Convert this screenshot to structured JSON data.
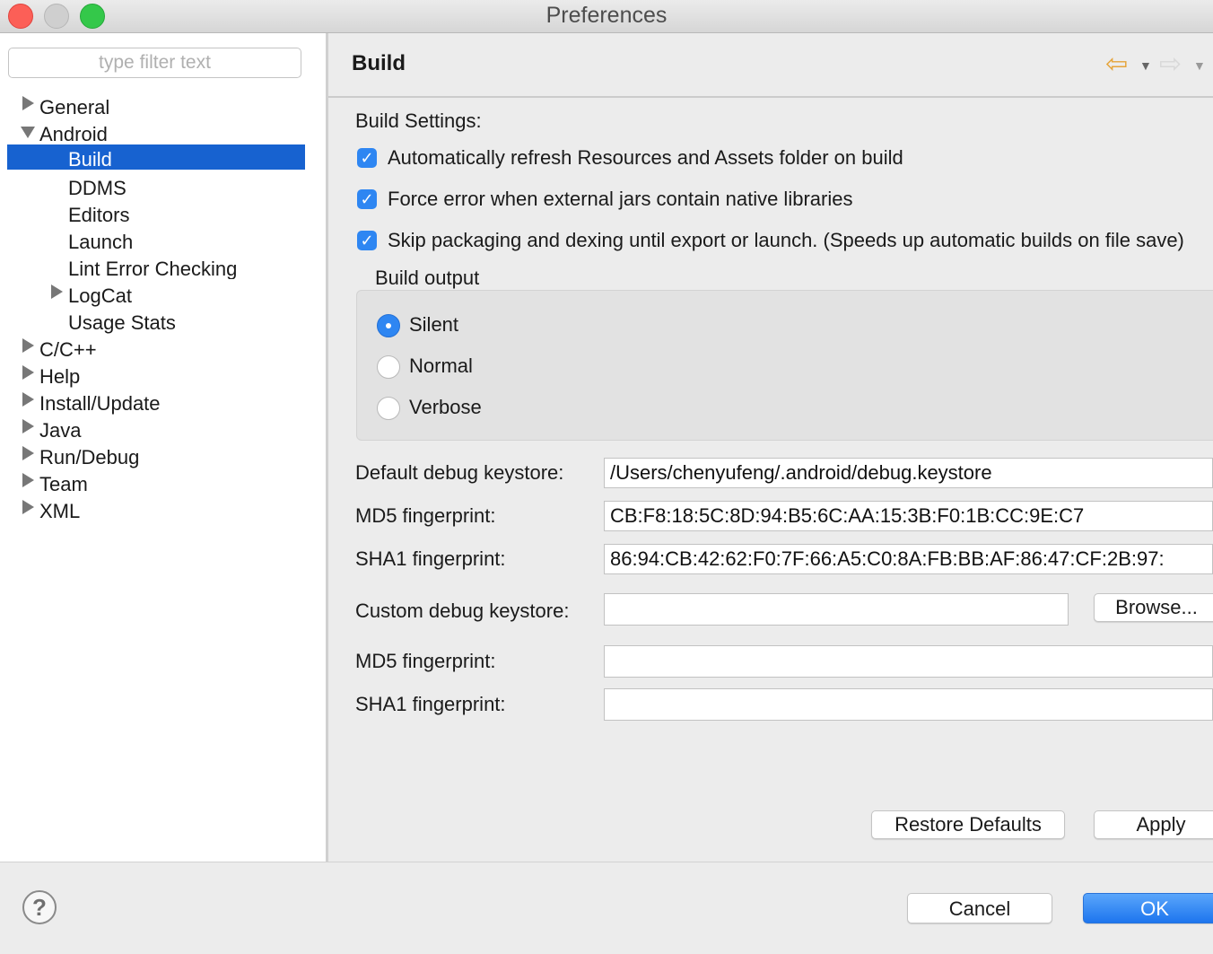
{
  "window": {
    "title": "Preferences"
  },
  "sidebar": {
    "filter_placeholder": "type filter text",
    "tree": [
      {
        "label": "General",
        "expander": "collapsed"
      },
      {
        "label": "Android",
        "expander": "expanded"
      },
      {
        "label": "Build",
        "selected": true
      },
      {
        "label": "DDMS"
      },
      {
        "label": "Editors"
      },
      {
        "label": "Launch"
      },
      {
        "label": "Lint Error Checking"
      },
      {
        "label": "LogCat",
        "expander": "collapsed"
      },
      {
        "label": "Usage Stats"
      },
      {
        "label": "C/C++",
        "expander": "collapsed"
      },
      {
        "label": "Help",
        "expander": "collapsed"
      },
      {
        "label": "Install/Update",
        "expander": "collapsed"
      },
      {
        "label": "Java",
        "expander": "collapsed"
      },
      {
        "label": "Run/Debug",
        "expander": "collapsed"
      },
      {
        "label": "Team",
        "expander": "collapsed"
      },
      {
        "label": "XML",
        "expander": "collapsed"
      }
    ]
  },
  "page": {
    "title": "Build",
    "nav_back_icon": "back-arrow-icon",
    "nav_forward_icon": "forward-arrow-icon",
    "build_settings_label": "Build Settings:",
    "checkboxes": [
      {
        "label": "Automatically refresh Resources and Assets folder on build",
        "checked": true
      },
      {
        "label": "Force error when external jars contain native libraries",
        "checked": true
      },
      {
        "label": "Skip packaging and dexing until export or launch. (Speeds up automatic builds on file save)",
        "checked": true
      }
    ],
    "build_output": {
      "label": "Build output",
      "options": [
        "Silent",
        "Normal",
        "Verbose"
      ],
      "selected": "Silent"
    },
    "default_keystore_label": "Default debug keystore:",
    "default_keystore_value": "/Users/chenyufeng/.android/debug.keystore",
    "md5_label": "MD5 fingerprint:",
    "md5_value": "CB:F8:18:5C:8D:94:B5:6C:AA:15:3B:F0:1B:CC:9E:C7",
    "sha1_label": "SHA1 fingerprint:",
    "sha1_value": "86:94:CB:42:62:F0:7F:66:A5:C0:8A:FB:BB:AF:86:47:CF:2B:97:",
    "custom_keystore_label": "Custom debug keystore:",
    "custom_keystore_value": "",
    "browse_label": "Browse...",
    "custom_md5_label": "MD5 fingerprint:",
    "custom_md5_value": "",
    "custom_sha1_label": "SHA1 fingerprint:",
    "custom_sha1_value": "",
    "restore_defaults_label": "Restore Defaults",
    "apply_label": "Apply"
  },
  "footer": {
    "help_glyph": "?",
    "cancel_label": "Cancel",
    "ok_label": "OK"
  },
  "colors": {
    "selection": "#1762d0",
    "checkbox": "#2e86f2",
    "back_arrow": "#e6a43a"
  }
}
